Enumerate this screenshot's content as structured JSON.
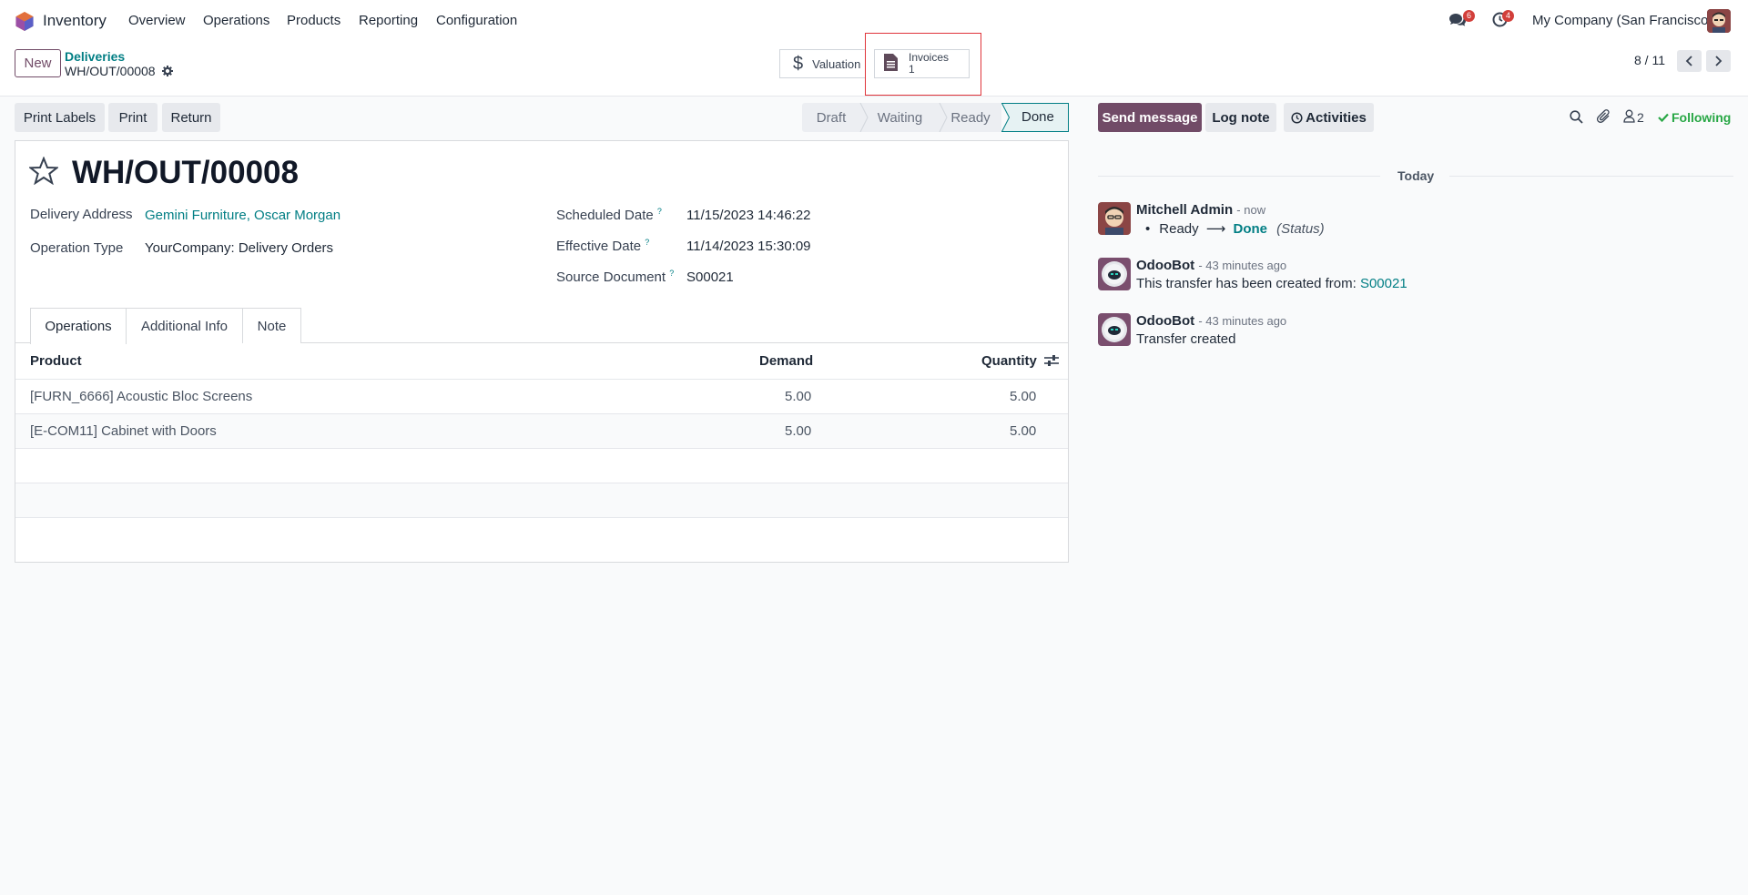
{
  "nav": {
    "app_name": "Inventory",
    "menu": [
      "Overview",
      "Operations",
      "Products",
      "Reporting",
      "Configuration"
    ],
    "messages_count": "6",
    "activities_count": "4",
    "company": "My Company (San Francisco)"
  },
  "control": {
    "new_label": "New",
    "breadcrumb_parent": "Deliveries",
    "breadcrumb_current": "WH/OUT/00008",
    "valuation_label": "Valuation",
    "invoices_label": "Invoices",
    "invoices_count": "1",
    "pager": "8 / 11"
  },
  "actions": {
    "print_labels": "Print Labels",
    "print": "Print",
    "return": "Return"
  },
  "statusbar": [
    "Draft",
    "Waiting",
    "Ready",
    "Done"
  ],
  "status_active": "Done",
  "form": {
    "title": "WH/OUT/00008",
    "delivery_address_label": "Delivery Address",
    "delivery_address": "Gemini Furniture, Oscar Morgan",
    "operation_type_label": "Operation Type",
    "operation_type": "YourCompany: Delivery Orders",
    "scheduled_date_label": "Scheduled Date",
    "scheduled_date": "11/15/2023 14:46:22",
    "effective_date_label": "Effective Date",
    "effective_date": "11/14/2023 15:30:09",
    "source_document_label": "Source Document",
    "source_document": "S00021",
    "help_mark": "?"
  },
  "tabs": [
    "Operations",
    "Additional Info",
    "Note"
  ],
  "table": {
    "headers": {
      "product": "Product",
      "demand": "Demand",
      "quantity": "Quantity"
    },
    "rows": [
      {
        "product": "[FURN_6666] Acoustic Bloc Screens",
        "demand": "5.00",
        "quantity": "5.00"
      },
      {
        "product": "[E-COM11] Cabinet with Doors",
        "demand": "5.00",
        "quantity": "5.00"
      }
    ]
  },
  "chatter": {
    "send_message": "Send message",
    "log_note": "Log note",
    "activities": "Activities",
    "followers_count": "2",
    "following": "Following",
    "today": "Today",
    "messages": [
      {
        "author": "Mitchell Admin",
        "time": "- now",
        "from": "Ready",
        "arrow": "⟶",
        "to": "Done",
        "field": "(Status)"
      },
      {
        "author": "OdooBot",
        "time": "- 43 minutes ago",
        "body": "This transfer has been created from:",
        "link": "S00021"
      },
      {
        "author": "OdooBot",
        "time": "- 43 minutes ago",
        "body": "Transfer created"
      }
    ]
  },
  "colors": {
    "brand": "#714b67",
    "link": "#017e84",
    "success": "#28a745",
    "badge": "#d23f3a"
  }
}
